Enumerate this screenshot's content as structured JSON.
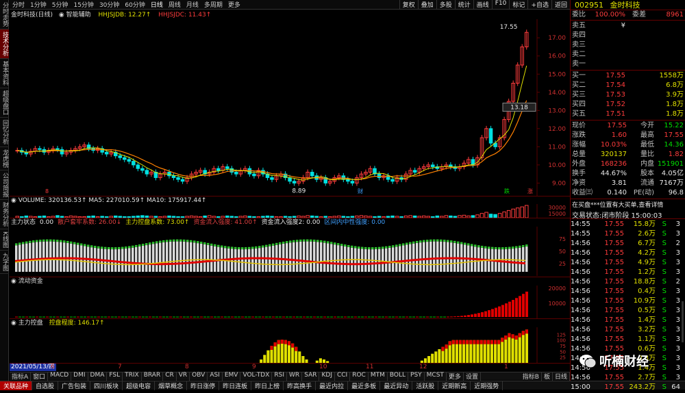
{
  "left_toolbar": [
    "分时走势",
    "技术分析",
    "基本资料",
    "超级盘口",
    "回忆分析",
    "龙虎榜",
    "公司简报",
    "财务分析",
    "K线图",
    "九字图"
  ],
  "top_toolbar": {
    "periods": [
      "分时",
      "1分钟",
      "5分钟",
      "15分钟",
      "30分钟",
      "60分钟",
      "日线",
      "周线",
      "月线",
      "多周期",
      "更多"
    ],
    "active_period": "日线",
    "right_buttons": [
      "复权",
      "叠加",
      "多股",
      "统计",
      "画线",
      "F10",
      "标记",
      "+自选",
      "返回"
    ]
  },
  "kline_header": {
    "stock": "金时科技(日线)",
    "assist": "智能辅助",
    "ind1": "HHJSJDB: 12.27↑",
    "ind2": "HHJSJDC: 11.43↑"
  },
  "kline": {
    "max_label": "17.55",
    "min_label": "8.89",
    "price_tag": "13.18",
    "yticks": [
      "17.00",
      "16.00",
      "15.00",
      "14.00",
      "13.00",
      "12.00",
      "11.00",
      "10.00",
      "9.00"
    ],
    "closes": [
      10.8,
      10.7,
      10.6,
      10.75,
      10.9,
      10.85,
      10.7,
      10.8,
      10.9,
      10.85,
      10.6,
      10.7,
      10.8,
      10.9,
      11.0,
      11.1,
      10.9,
      10.8,
      10.9,
      10.7,
      10.6,
      10.7,
      10.5,
      10.4,
      10.3,
      10.2,
      10.0,
      9.8,
      9.7,
      9.5,
      9.6,
      9.3,
      9.5,
      9.6,
      9.4,
      9.3,
      9.2,
      9.1,
      9.3,
      9.5,
      9.6,
      9.7,
      9.5,
      9.6,
      9.8,
      9.7,
      9.9,
      9.8,
      9.6,
      9.5,
      9.7,
      9.8,
      9.5,
      9.4,
      9.7,
      9.5,
      9.3,
      9.2,
      9.4,
      9.5,
      9.3,
      9.1,
      9.0,
      9.1,
      9.3,
      9.6,
      9.4,
      9.2,
      9.3,
      9.0,
      9.1,
      9.3,
      9.4,
      9.2,
      9.1,
      9.0,
      9.3,
      9.5,
      9.6,
      9.8,
      9.5,
      9.3,
      9.4,
      9.2,
      9.1,
      9.3,
      9.2,
      9.5,
      9.7,
      9.6,
      9.8,
      9.9,
      10.0,
      9.9,
      9.8,
      9.9,
      10.0,
      9.9,
      9.8,
      9.9,
      10.1,
      10.3,
      10.0,
      10.4,
      11.5,
      12.0,
      11.2,
      11.0,
      11.5,
      12.5,
      13.5,
      14.5,
      15.5,
      16.5,
      17.3
    ],
    "markers": [
      "8",
      "财",
      "跌",
      "涨"
    ]
  },
  "xaxis": {
    "date_box": "2021/05/13/四",
    "months": [
      "6",
      "7",
      "8",
      "9",
      "10",
      "11",
      "12",
      "1"
    ]
  },
  "volume": {
    "header": "VOLUME: 320136.53↑  MA5: 227010.59↑  MA10: 175917.44↑",
    "yticks": [
      "30000",
      "15000"
    ],
    "values": [
      4,
      3,
      5,
      4,
      3,
      4,
      5,
      3,
      4,
      6,
      4,
      3,
      5,
      4,
      3,
      3,
      4,
      5,
      3,
      4,
      3,
      4,
      5,
      4,
      3,
      3,
      4,
      5,
      6,
      5,
      4,
      4,
      3,
      4,
      5,
      4,
      3,
      3,
      4,
      5,
      4,
      3,
      5,
      6,
      4,
      3,
      4,
      5,
      4,
      3,
      4,
      5,
      4,
      3,
      3,
      4,
      5,
      4,
      3,
      3,
      4,
      3,
      4,
      5,
      4,
      6,
      5,
      4,
      3,
      4,
      3,
      4,
      5,
      4,
      3,
      4,
      5,
      6,
      5,
      4,
      3,
      4,
      3,
      4,
      5,
      4,
      3,
      5,
      6,
      5,
      4,
      5,
      4,
      3,
      5,
      4,
      6,
      5,
      4,
      6,
      7,
      5,
      6,
      8,
      12,
      15,
      10,
      9,
      12,
      16,
      20,
      24,
      27,
      30,
      34
    ]
  },
  "main_state": {
    "header_label": "主力状态",
    "items": [
      "0.00",
      "散户套牢系数: 26.00↓",
      "主力控盘系数: 73.00↑",
      "资金流入强度: 41.00↑",
      "资金流入强度2: 0.00",
      "区间内中性强度: 0.00"
    ],
    "yticks": [
      "75",
      "50",
      "25"
    ]
  },
  "flow": {
    "header_label": "流动资金",
    "yticks": [
      "20000",
      "10000"
    ]
  },
  "control": {
    "header_label": "主力控盘",
    "value": "控盘程度: 146.17↑",
    "yticks": [
      "125",
      "100",
      "75",
      "50",
      "25"
    ],
    "values": [
      0,
      0,
      0,
      0,
      0,
      0,
      0,
      0,
      0,
      0,
      0,
      0,
      0,
      0,
      0,
      0,
      0,
      0,
      0,
      0,
      0,
      0,
      0,
      0,
      0,
      0,
      0,
      0,
      0,
      0,
      0,
      0,
      0,
      0,
      0,
      0,
      0,
      0,
      0,
      0,
      0,
      0,
      0,
      0,
      0,
      0,
      0,
      0,
      0,
      0,
      0,
      0,
      0,
      0,
      0,
      0,
      0,
      0,
      0,
      0,
      0,
      0,
      0,
      0,
      0,
      0,
      0,
      0,
      0,
      0,
      15,
      35,
      55,
      75,
      90,
      100,
      102,
      100,
      95,
      85,
      70,
      50,
      30,
      15,
      0,
      0,
      10,
      20,
      15,
      8,
      0,
      0,
      0,
      0,
      0,
      0,
      0,
      0,
      0,
      0,
      0,
      0,
      0,
      0,
      0,
      0,
      0,
      0,
      0,
      0,
      0,
      0,
      0,
      0,
      0,
      0,
      10,
      20,
      30,
      40,
      50,
      60,
      70,
      80,
      95,
      100,
      100,
      100,
      100,
      100,
      100,
      100,
      100,
      100,
      100,
      100,
      100,
      100,
      100,
      110,
      120,
      130,
      125,
      120,
      130,
      140,
      146
    ]
  },
  "indicator_bar": [
    "指标A",
    "窗口",
    "MACD",
    "DMI",
    "DMA",
    "FSL",
    "TRIX",
    "BRAR",
    "CR",
    "VR",
    "OBV",
    "ASI",
    "EMV",
    "VOL-TDX",
    "RSI",
    "WR",
    "SAR",
    "KDJ",
    "CCI",
    "ROC",
    "MTM",
    "BOLL",
    "PSY",
    "MCST",
    "更多",
    "设置"
  ],
  "indicator_right": [
    "指标B",
    "板",
    "日线"
  ],
  "bottom_bar": [
    "关联品种",
    "自选股",
    "广告包装",
    "四川板块",
    "超级电容",
    "烟草概念",
    "昨日涨停",
    "昨日连板",
    "昨日上榜",
    "昨高换手",
    "最近内拉",
    "最近多板",
    "最近异动",
    "活跃股",
    "近期新高",
    "近期强势"
  ],
  "quote": {
    "code": "002951",
    "name": "金时科技",
    "weibi_label": "委比",
    "weibi": "100.00%",
    "weicha_label": "委差",
    "weicha": "8961",
    "sells": [
      {
        "label": "卖五",
        "price": "¥",
        "vol": ""
      },
      {
        "label": "卖四",
        "price": "",
        "vol": ""
      },
      {
        "label": "卖三",
        "price": "",
        "vol": ""
      },
      {
        "label": "卖二",
        "price": "",
        "vol": ""
      },
      {
        "label": "卖一",
        "price": "",
        "vol": ""
      }
    ],
    "buys": [
      {
        "label": "买一",
        "price": "17.55",
        "vol": "1558万"
      },
      {
        "label": "买二",
        "price": "17.54",
        "vol": "6.8万"
      },
      {
        "label": "买三",
        "price": "17.53",
        "vol": "3.9万"
      },
      {
        "label": "买四",
        "price": "17.52",
        "vol": "1.8万"
      },
      {
        "label": "买五",
        "price": "17.51",
        "vol": "1.8万"
      }
    ],
    "stats": [
      {
        "l1": "现价",
        "v1": "17.55",
        "c1": "red",
        "l2": "今开",
        "v2": "15.22",
        "c2": "green"
      },
      {
        "l1": "涨跌",
        "v1": "1.60",
        "c1": "red",
        "l2": "最高",
        "v2": "17.55",
        "c2": "red"
      },
      {
        "l1": "涨幅",
        "v1": "10.03%",
        "c1": "red",
        "l2": "最低",
        "v2": "14.36",
        "c2": "green"
      },
      {
        "l1": "总量",
        "v1": "320137",
        "c1": "yellow",
        "l2": "量比",
        "v2": "1.82",
        "c2": "red"
      },
      {
        "l1": "外盘",
        "v1": "168236",
        "c1": "red",
        "l2": "内盘",
        "v2": "151901",
        "c2": "green"
      },
      {
        "l1": "换手",
        "v1": "44.67%",
        "c1": "white",
        "l2": "股本",
        "v2": "4.05亿",
        "c2": "white"
      },
      {
        "l1": "净资",
        "v1": "3.81",
        "c1": "white",
        "l2": "流通",
        "v2": "7167万",
        "c2": "white"
      },
      {
        "l1": "收益㈢",
        "v1": "0.140",
        "c1": "white",
        "l2": "PE(动)",
        "v2": "96.8",
        "c2": "white"
      }
    ],
    "notice": "在买盘***位置有大买单,查看详情",
    "status_label": "交易状态:",
    "status_value": "闭市阶段 15:00:03",
    "ticks": [
      {
        "t": "14:55",
        "p": "17.55",
        "v": "15.8万",
        "s": "S",
        "n": "3"
      },
      {
        "t": "14:55",
        "p": "17.55",
        "v": "2.6万",
        "s": "S",
        "n": "3"
      },
      {
        "t": "14:56",
        "p": "17.55",
        "v": "6.7万",
        "s": "S",
        "n": "2"
      },
      {
        "t": "14:56",
        "p": "17.55",
        "v": "4.2万",
        "s": "S",
        "n": "3"
      },
      {
        "t": "14:56",
        "p": "17.55",
        "v": "4.9万",
        "s": "S",
        "n": "3"
      },
      {
        "t": "14:56",
        "p": "17.55",
        "v": "1.2万",
        "s": "S",
        "n": "3"
      },
      {
        "t": "14:56",
        "p": "17.55",
        "v": "18.8万",
        "s": "S",
        "n": "2"
      },
      {
        "t": "14:56",
        "p": "17.55",
        "v": "0.4万",
        "s": "S",
        "n": "3"
      },
      {
        "t": "14:56",
        "p": "17.55",
        "v": "10.9万",
        "s": "S",
        "n": "3"
      },
      {
        "t": "14:56",
        "p": "17.55",
        "v": "0.5万",
        "s": "S",
        "n": "3"
      },
      {
        "t": "14:56",
        "p": "17.55",
        "v": "1.4万",
        "s": "S",
        "n": "3"
      },
      {
        "t": "14:56",
        "p": "17.55",
        "v": "3.2万",
        "s": "S",
        "n": "3"
      },
      {
        "t": "14:56",
        "p": "17.55",
        "v": "1.1万",
        "s": "S",
        "n": "3"
      },
      {
        "t": "14:56",
        "p": "17.55",
        "v": "0.6万",
        "s": "S",
        "n": "3"
      },
      {
        "t": "14:56",
        "p": "17.55",
        "v": "0.8万",
        "s": "S",
        "n": "3"
      },
      {
        "t": "14:56",
        "p": "17.55",
        "v": "1.4万",
        "s": "S",
        "n": "3"
      },
      {
        "t": "14:56",
        "p": "17.55",
        "v": "2.7万",
        "s": "S",
        "n": "3"
      },
      {
        "t": "15:00",
        "p": "17.55",
        "v": "243.2万",
        "s": "S",
        "n": "64"
      }
    ]
  },
  "watermark": "听楠财经",
  "colors": {
    "up": "#ff3c3c",
    "down": "#00e0e0",
    "ma5": "#e0e000",
    "ma10": "#ff8000",
    "grid": "#5a0000"
  }
}
